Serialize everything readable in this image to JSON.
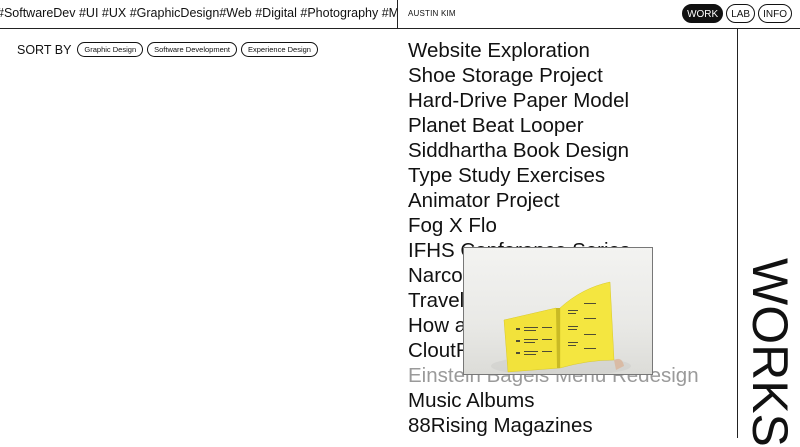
{
  "header": {
    "tags_marquee": "#SoftwareDev #UI #UX #GraphicDesign#Web #Digital #Photography #Music #",
    "brand": "AUSTIN KIM",
    "nav": [
      "WORK",
      "LAB",
      "INFO"
    ],
    "active_nav": "WORK"
  },
  "sort": {
    "label": "SORT BY",
    "filters": [
      "Graphic Design",
      "Software Development",
      "Experience Design"
    ]
  },
  "projects": [
    "Website Exploration",
    "Shoe Storage Project",
    "Hard-Drive Paper Model",
    "Planet Beat Looper",
    "Siddhartha Book Design",
    "Type Study Exercises",
    "Animator Project",
    "Fog X Flo",
    "IFHS Conference Series",
    "Narco",
    "Travel",
    "How a",
    "CloutR",
    "Einstein Bagels Menu Redesign",
    "Music Albums",
    "88Rising Magazines"
  ],
  "hovered_project": "Einstein Bagels Menu Redesign",
  "section_title": "WORKS",
  "colors": {
    "accent": "#111111",
    "hover_text": "#9a9a9a",
    "preview_yellow": "#f2e23b"
  }
}
